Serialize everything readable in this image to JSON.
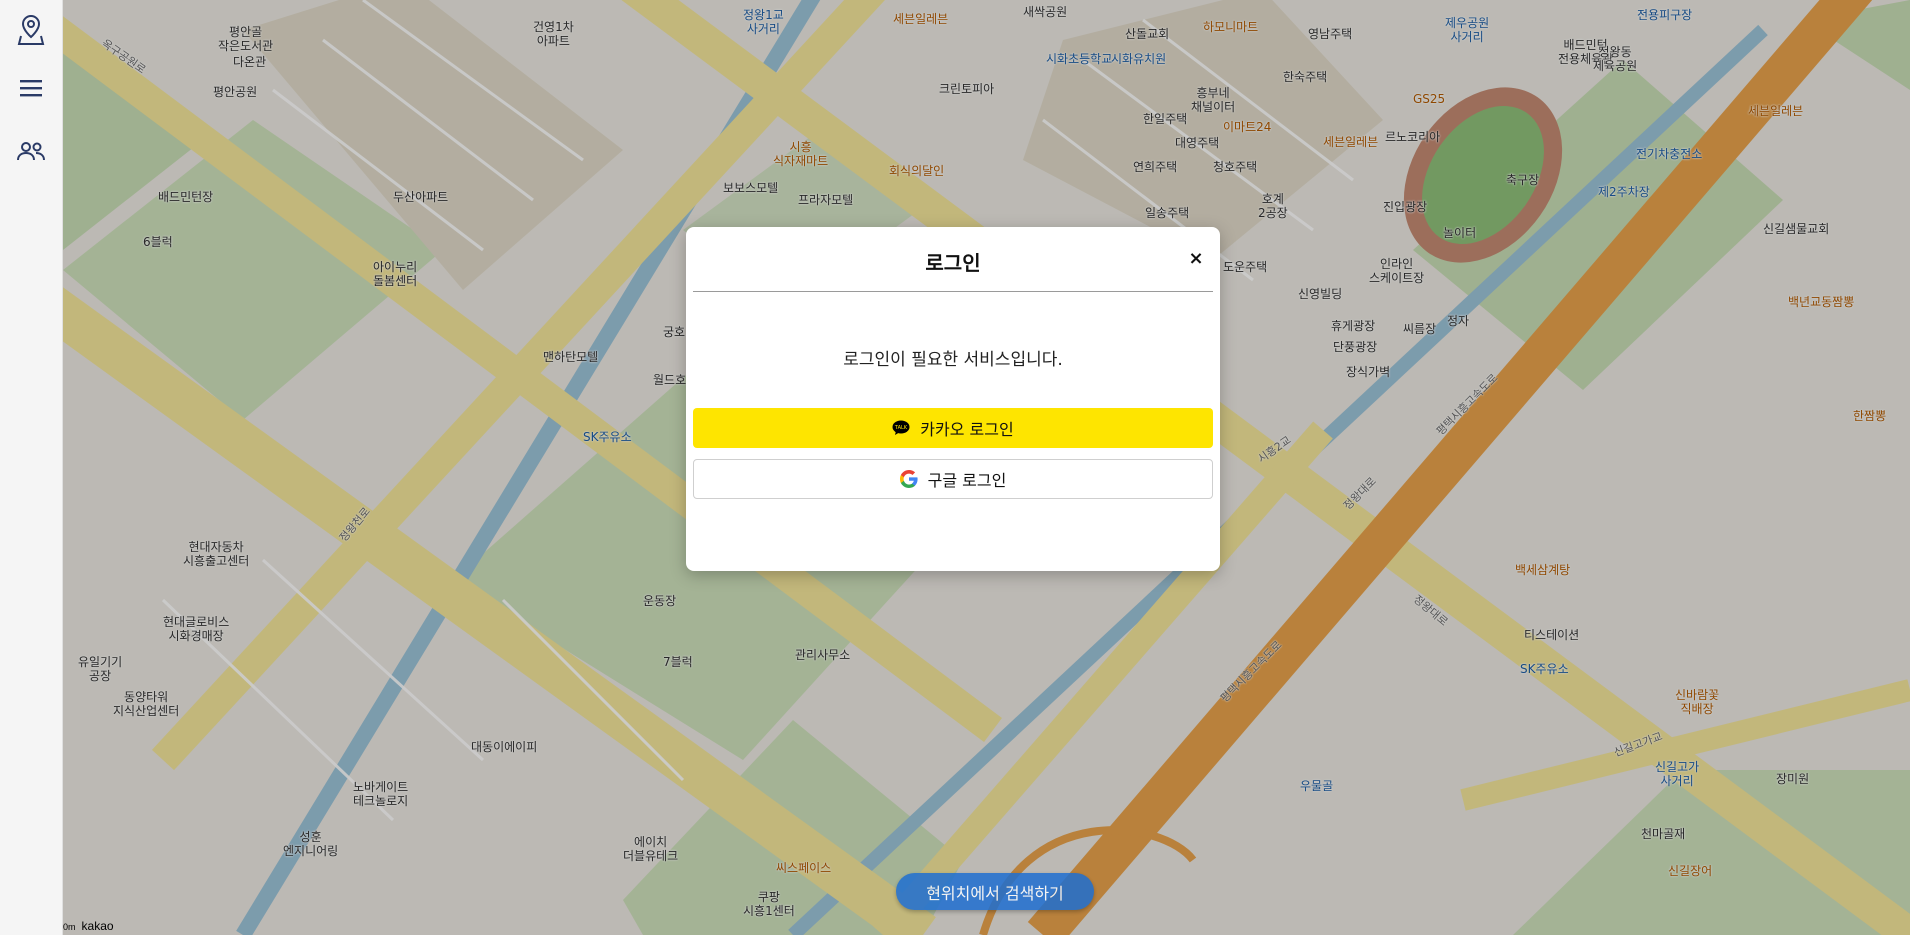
{
  "sidebar": {
    "items": [
      {
        "icon": "map-pin-icon",
        "label": ""
      },
      {
        "icon": "menu-icon",
        "label": ""
      },
      {
        "icon": "users-icon",
        "label": ""
      }
    ]
  },
  "map": {
    "labels": [
      {
        "text": "평안골\n작은도서관",
        "kind": "default"
      },
      {
        "text": "다온관",
        "kind": "default"
      },
      {
        "text": "평안공원",
        "kind": "default"
      },
      {
        "text": "배드민턴장",
        "kind": "default"
      },
      {
        "text": "6블럭",
        "kind": "default"
      },
      {
        "text": "두산아파트",
        "kind": "default"
      },
      {
        "text": "아이누리\n돌봄센터",
        "kind": "default"
      },
      {
        "text": "건영1차\n아파트",
        "kind": "default"
      },
      {
        "text": "현대자동차\n시흥출고센터",
        "kind": "default"
      },
      {
        "text": "현대글로비스\n시화경매장",
        "kind": "default"
      },
      {
        "text": "유일기기\n공장",
        "kind": "default"
      },
      {
        "text": "동양타워\n지식산업센터",
        "kind": "default"
      },
      {
        "text": "대동이에이피",
        "kind": "default"
      },
      {
        "text": "노바게이트\n테크놀로지",
        "kind": "default"
      },
      {
        "text": "성훈\n엔지니어링",
        "kind": "default"
      },
      {
        "text": "에이치\n더블유테크",
        "kind": "default"
      },
      {
        "text": "쿠팡\n시흥1센터",
        "kind": "default"
      },
      {
        "text": "7블럭",
        "kind": "default"
      },
      {
        "text": "운동장",
        "kind": "default"
      },
      {
        "text": "관리사무소",
        "kind": "default"
      },
      {
        "text": "SK주유소",
        "kind": "blue"
      },
      {
        "text": "맨하탄모텔",
        "kind": "default"
      },
      {
        "text": "월드호",
        "kind": "default"
      },
      {
        "text": "궁호",
        "kind": "default"
      },
      {
        "text": "보보스모텔",
        "kind": "default"
      },
      {
        "text": "프라자모텔",
        "kind": "default"
      },
      {
        "text": "시흥\n식자재마트",
        "kind": "orange"
      },
      {
        "text": "회식의달인",
        "kind": "orange"
      },
      {
        "text": "크린토피아",
        "kind": "default"
      },
      {
        "text": "세븐일레븐",
        "kind": "orange"
      },
      {
        "text": "정왕1교\n사거리",
        "kind": "blue"
      },
      {
        "text": "새싹공원",
        "kind": "default"
      },
      {
        "text": "시화초등학교",
        "kind": "blue"
      },
      {
        "text": "산돌교회",
        "kind": "default"
      },
      {
        "text": "시화유치원",
        "kind": "blue"
      },
      {
        "text": "하모니마트",
        "kind": "orange"
      },
      {
        "text": "영남주택",
        "kind": "default"
      },
      {
        "text": "한숙주택",
        "kind": "default"
      },
      {
        "text": "흥부네\n채널이터",
        "kind": "default"
      },
      {
        "text": "이마트24",
        "kind": "orange"
      },
      {
        "text": "한일주택",
        "kind": "default"
      },
      {
        "text": "대영주택",
        "kind": "default"
      },
      {
        "text": "연희주택",
        "kind": "default"
      },
      {
        "text": "청호주택",
        "kind": "default"
      },
      {
        "text": "르노코리아",
        "kind": "default"
      },
      {
        "text": "GS25",
        "kind": "orange"
      },
      {
        "text": "일송주택",
        "kind": "default"
      },
      {
        "text": "호계\n2공장",
        "kind": "default"
      },
      {
        "text": "세븐일레븐",
        "kind": "orange"
      },
      {
        "text": "도운주택",
        "kind": "default"
      },
      {
        "text": "신영빌딩",
        "kind": "default"
      },
      {
        "text": "인라인\n스케이트장",
        "kind": "default"
      },
      {
        "text": "진입광장",
        "kind": "default"
      },
      {
        "text": "놀이터",
        "kind": "default"
      },
      {
        "text": "씨름장",
        "kind": "default"
      },
      {
        "text": "정자",
        "kind": "default"
      },
      {
        "text": "휴게광장",
        "kind": "default"
      },
      {
        "text": "단풍광장",
        "kind": "default"
      },
      {
        "text": "장식가벽",
        "kind": "default"
      },
      {
        "text": "제우공원\n사거리",
        "kind": "blue"
      },
      {
        "text": "배드민턴\n전용체육관",
        "kind": "default"
      },
      {
        "text": "정왕동\n제육공원",
        "kind": "default"
      },
      {
        "text": "전용피구장",
        "kind": "blue"
      },
      {
        "text": "축구장",
        "kind": "default"
      },
      {
        "text": "전기차충전소",
        "kind": "blue"
      },
      {
        "text": "제2주차장",
        "kind": "blue"
      },
      {
        "text": "신길샘물교회",
        "kind": "default"
      },
      {
        "text": "세븐일레븐",
        "kind": "orange"
      },
      {
        "text": "백년교동짬뽕",
        "kind": "orange"
      },
      {
        "text": "한짬뽕",
        "kind": "orange"
      },
      {
        "text": "시흥2교",
        "kind": "road"
      },
      {
        "text": "백세삼계탕",
        "kind": "orange"
      },
      {
        "text": "티스테이션",
        "kind": "default"
      },
      {
        "text": "SK주유소",
        "kind": "blue"
      },
      {
        "text": "신바람꽃\n직배장",
        "kind": "orange"
      },
      {
        "text": "신길고가\n사거리",
        "kind": "blue"
      },
      {
        "text": "장미원",
        "kind": "default"
      },
      {
        "text": "천마골재",
        "kind": "default"
      },
      {
        "text": "신길장어",
        "kind": "orange"
      },
      {
        "text": "우물골",
        "kind": "blue"
      },
      {
        "text": "씨스페이스",
        "kind": "orange"
      },
      {
        "text": "평택시흥고속도로",
        "kind": "road"
      },
      {
        "text": "평택시흥고속도로",
        "kind": "road"
      },
      {
        "text": "정왕대로",
        "kind": "road"
      },
      {
        "text": "정왕대로",
        "kind": "road"
      },
      {
        "text": "신길고가교",
        "kind": "road"
      },
      {
        "text": "정왕천로",
        "kind": "road"
      },
      {
        "text": "옥구공원로",
        "kind": "road"
      }
    ]
  },
  "attribution": {
    "scale": "0m",
    "brand": "kakao"
  },
  "search_here": {
    "label": "현위치에서 검색하기"
  },
  "login_modal": {
    "title": "로그인",
    "close": "×",
    "message": "로그인이 필요한 서비스입니다.",
    "kakao_button": "카카오 로그인",
    "google_button": "구글 로그인"
  },
  "colors": {
    "kakao_yellow": "#FEE500",
    "search_blue": "#1F6FD1",
    "sidebar_icon": "#2a3a66"
  }
}
